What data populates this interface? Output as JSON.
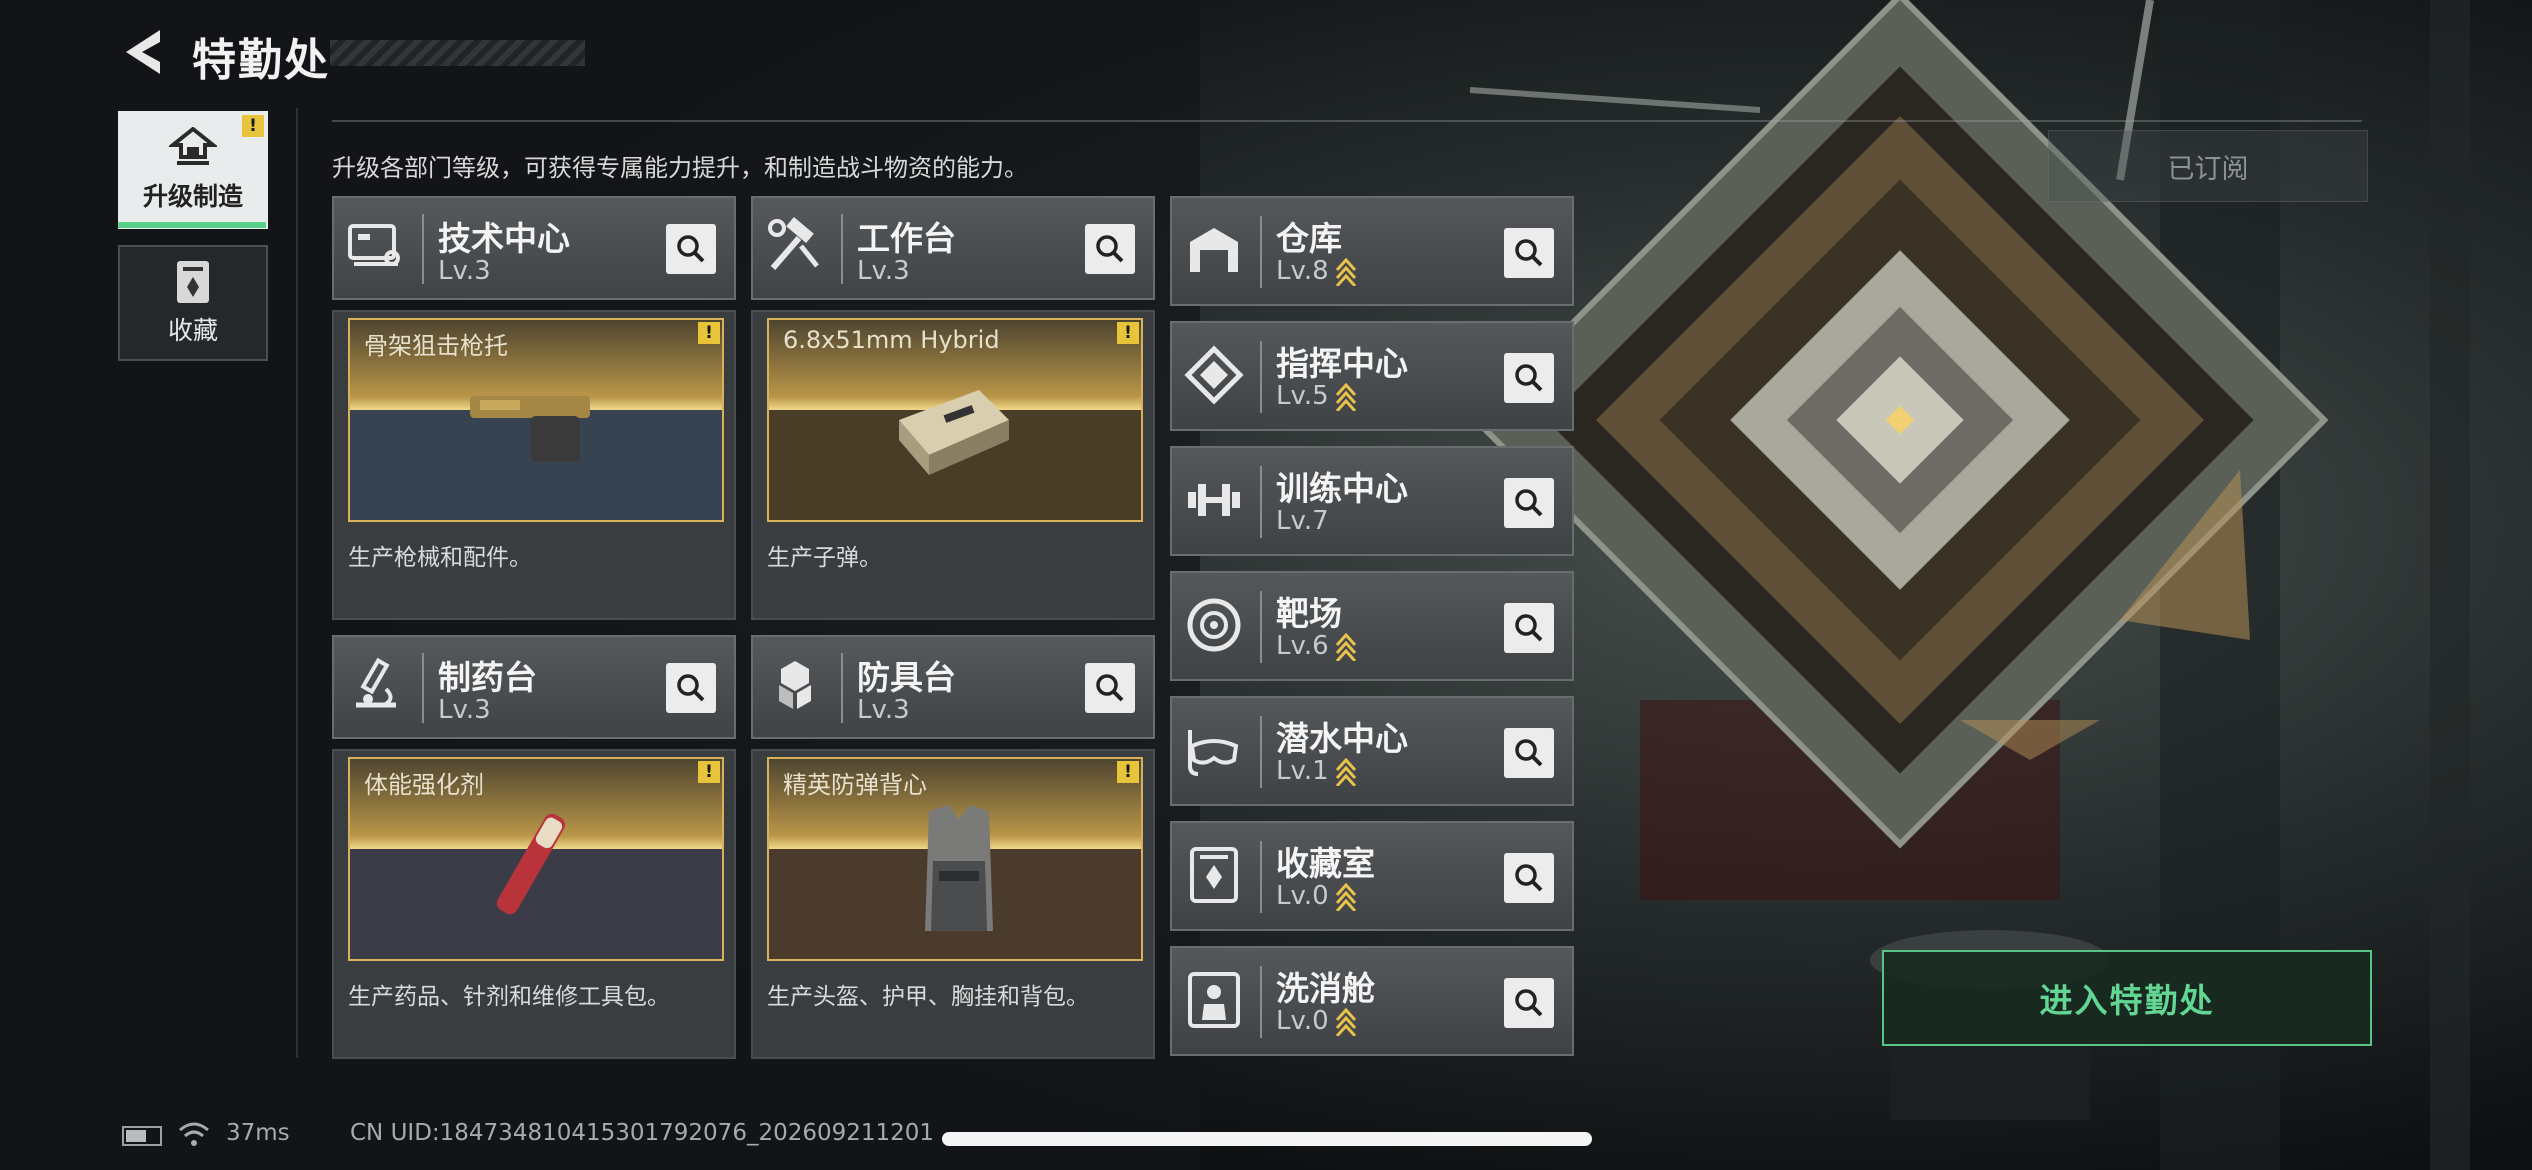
{
  "header": {
    "title": "特勤处",
    "back_icon": "back-arrow-icon"
  },
  "nav": {
    "tabs": [
      {
        "label": "升级制造",
        "icon": "upgrade-icon",
        "active": true,
        "warning": "!"
      },
      {
        "label": "收藏",
        "icon": "collection-icon",
        "active": false
      }
    ]
  },
  "description": "升级各部门等级，可获得专属能力提升，和制造战斗物资的能力。",
  "subscribed_label": "已订阅",
  "workshops": [
    {
      "name": "技术中心",
      "level": "Lv.3",
      "icon": "tech-center-icon",
      "item_name": "骨架狙击枪托",
      "item_warning": "!",
      "desc": "生产枪械和配件。"
    },
    {
      "name": "工作台",
      "level": "Lv.3",
      "icon": "workbench-icon",
      "item_name": "6.8x51mm Hybrid",
      "item_warning": "!",
      "desc": "生产子弹。"
    },
    {
      "name": "制药台",
      "level": "Lv.3",
      "icon": "pharmacy-icon",
      "item_name": "体能强化剂",
      "item_warning": "!",
      "desc": "生产药品、针剂和维修工具包。"
    },
    {
      "name": "防具台",
      "level": "Lv.3",
      "icon": "armor-bench-icon",
      "item_name": "精英防弹背心",
      "item_warning": "!",
      "desc": "生产头盔、护甲、胸挂和背包。"
    }
  ],
  "facilities": [
    {
      "name": "仓库",
      "level": "Lv.8",
      "icon": "warehouse-icon",
      "upgradable": true
    },
    {
      "name": "指挥中心",
      "level": "Lv.5",
      "icon": "command-center-icon",
      "upgradable": true
    },
    {
      "name": "训练中心",
      "level": "Lv.7",
      "icon": "training-center-icon",
      "upgradable": false
    },
    {
      "name": "靶场",
      "level": "Lv.6",
      "icon": "shooting-range-icon",
      "upgradable": true
    },
    {
      "name": "潜水中心",
      "level": "Lv.1",
      "icon": "diving-center-icon",
      "upgradable": true
    },
    {
      "name": "收藏室",
      "level": "Lv.0",
      "icon": "collection-room-icon",
      "upgradable": true
    },
    {
      "name": "洗消舱",
      "level": "Lv.0",
      "icon": "decontamination-icon",
      "upgradable": true
    }
  ],
  "enter_button": "进入特勤处",
  "status": {
    "ping": "37ms",
    "uid": "CN UID:184734810415301792076_202609211201"
  },
  "colors": {
    "accent_green": "#5bd08a",
    "item_gold": "#d9b15a",
    "warning_yellow": "#e7c43a",
    "upgrade_arrow": "#e8c24a"
  }
}
